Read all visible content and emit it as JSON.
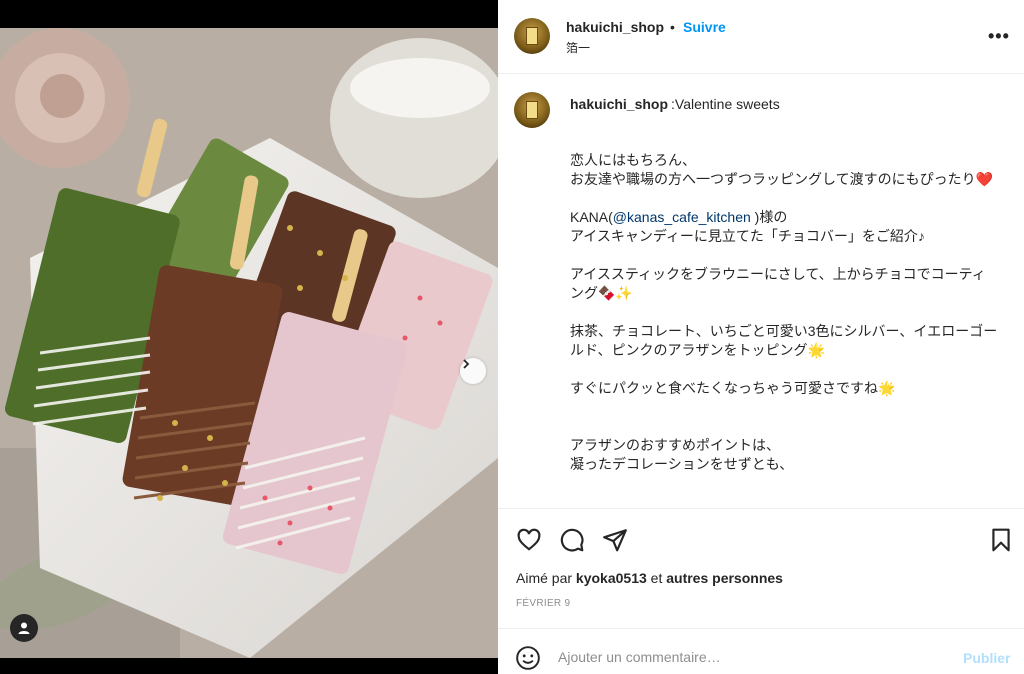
{
  "post": {
    "username": "hakuichi_shop",
    "follow_label": "Suivre",
    "separator": "•",
    "location": "箔一",
    "more_label": "•••"
  },
  "caption": {
    "username": "hakuichi_shop",
    "title": ":Valentine sweets",
    "line1": "恋人にはもちろん、",
    "line2": "お友達や職場の方へ一つずつラッピングして渡すのにもぴったり",
    "heart": "❤️",
    "line3_prefix": "KANA(",
    "mention": "@kanas_cafe_kitchen",
    "line3_suffix": " )様の",
    "line4": "アイスキャンディーに見立てた「チョコバー」をご紹介♪",
    "line5": "アイススティックをブラウニーにさして、上からチョコでコーティング",
    "line5_emoji": "🍫✨",
    "line6": "抹茶、チョコレート、いちごと可愛い3色にシルバー、イエローゴールド、ピンクのアラザンをトッピング",
    "line6_end": "🌟",
    "line7": "すぐにパクッと食べたくなっちゃう可愛さですね",
    "line7_end": "🌟",
    "line8": "アラザンのおすすめポイントは、",
    "line9": "凝ったデコレーションをせずとも、"
  },
  "likes": {
    "prefix": "Aimé par ",
    "user": "kyoka0513",
    "middle": " et ",
    "suffix": "autres personnes"
  },
  "date": "FÉVRIER 9",
  "comment": {
    "placeholder": "Ajouter un commentaire…",
    "publish_label": "Publier"
  },
  "icons": {
    "like": "heart-icon",
    "comment": "comment-icon",
    "share": "share-icon",
    "save": "bookmark-icon",
    "emoji": "emoji-icon",
    "next": "chevron-right-icon",
    "tag": "user-tag-icon"
  },
  "colors": {
    "accent": "#0095f6",
    "publish_disabled": "#b2dffc",
    "mention": "#00376b"
  }
}
